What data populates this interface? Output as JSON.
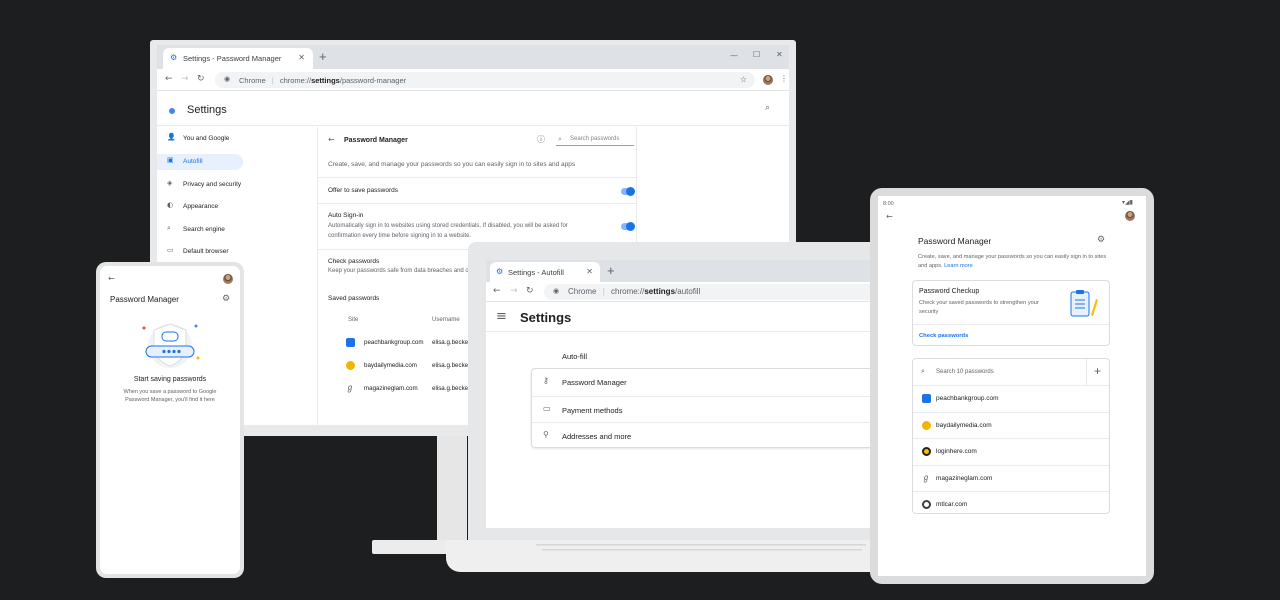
{
  "monitor": {
    "tab_title": "Settings - Password Manager",
    "new_tab_symbol": "+",
    "omnibox": {
      "origin": "Chrome",
      "separator": "|",
      "url_prefix": "chrome://",
      "url_bold": "settings",
      "url_suffix": "/password-manager"
    },
    "page_title": "Settings",
    "sidebar": [
      {
        "label": "You and Google",
        "icon": "person-icon"
      },
      {
        "label": "Autofill",
        "icon": "autofill-icon",
        "active": true
      },
      {
        "label": "Privacy and security",
        "icon": "shield-icon"
      },
      {
        "label": "Appearance",
        "icon": "palette-icon"
      },
      {
        "label": "Search engine",
        "icon": "search-icon"
      },
      {
        "label": "Default browser",
        "icon": "browser-icon"
      }
    ],
    "password_manager": {
      "title": "Password Manager",
      "search_placeholder": "Search passwords",
      "description": "Create, save, and manage your passwords so you can easily sign in to sites and apps",
      "offer_to_save": "Offer to save passwords",
      "auto_signin_title": "Auto Sign-in",
      "auto_signin_desc": "Automatically sign in to websites using stored credentials. If disabled, you will be asked for confirmation every time before signing in to a website.",
      "check_title": "Check passwords",
      "check_desc": "Keep your passwords safe from data breaches and ot",
      "saved_title": "Saved passwords",
      "col_site": "Site",
      "col_username": "Username",
      "saved": [
        {
          "site": "peachbankgroup.com",
          "username": "elisa.g.becket@",
          "color": "#1a73e8"
        },
        {
          "site": "baydailymedia.com",
          "username": "elisa.g.becket@",
          "color": "#f4b400"
        },
        {
          "site": "magazineglam.com",
          "username": "elisa.g.becket@",
          "color": "#5f6368"
        }
      ]
    }
  },
  "laptop": {
    "tab_title": "Settings - Autofill",
    "new_tab_symbol": "+",
    "omnibox": {
      "origin": "Chrome",
      "separator": "|",
      "url_prefix": "chrome://",
      "url_bold": "settings",
      "url_suffix": "/autofill"
    },
    "page_title": "Settings",
    "section_title": "Auto-fill",
    "items": [
      {
        "label": "Password Manager",
        "icon": "key-icon"
      },
      {
        "label": "Payment methods",
        "icon": "credit-card-icon"
      },
      {
        "label": "Addresses and more",
        "icon": "location-pin-icon"
      }
    ]
  },
  "phone": {
    "title": "Password Manager",
    "empty_title": "Start saving passwords",
    "empty_desc": "When you save a password to Google Password Manager, you'll find it here"
  },
  "tablet": {
    "time": "8:00",
    "title": "Password Manager",
    "description": "Create, save, and manage your passwords so you can easily sign in to sites and apps.",
    "learn_more": "Learn more",
    "checkup_title": "Password Checkup",
    "checkup_desc": "Check your saved passwords to strengthen your security",
    "check_link": "Check passwords",
    "search_placeholder": "Search 10 passwords",
    "add_symbol": "+",
    "sites": [
      {
        "site": "peachbankgroup.com",
        "color": "#1a73e8"
      },
      {
        "site": "baydailymedia.com",
        "color": "#f4b400"
      },
      {
        "site": "loginhere.com",
        "color": "#fbbc04"
      },
      {
        "site": "magazineglam.com",
        "color": "#5f6368"
      },
      {
        "site": "mtlcar.com",
        "color": "#3c4043"
      }
    ]
  },
  "colors": {
    "background": "#1c1e1f",
    "accent": "#1a73e8",
    "link": "#1a73e8"
  }
}
